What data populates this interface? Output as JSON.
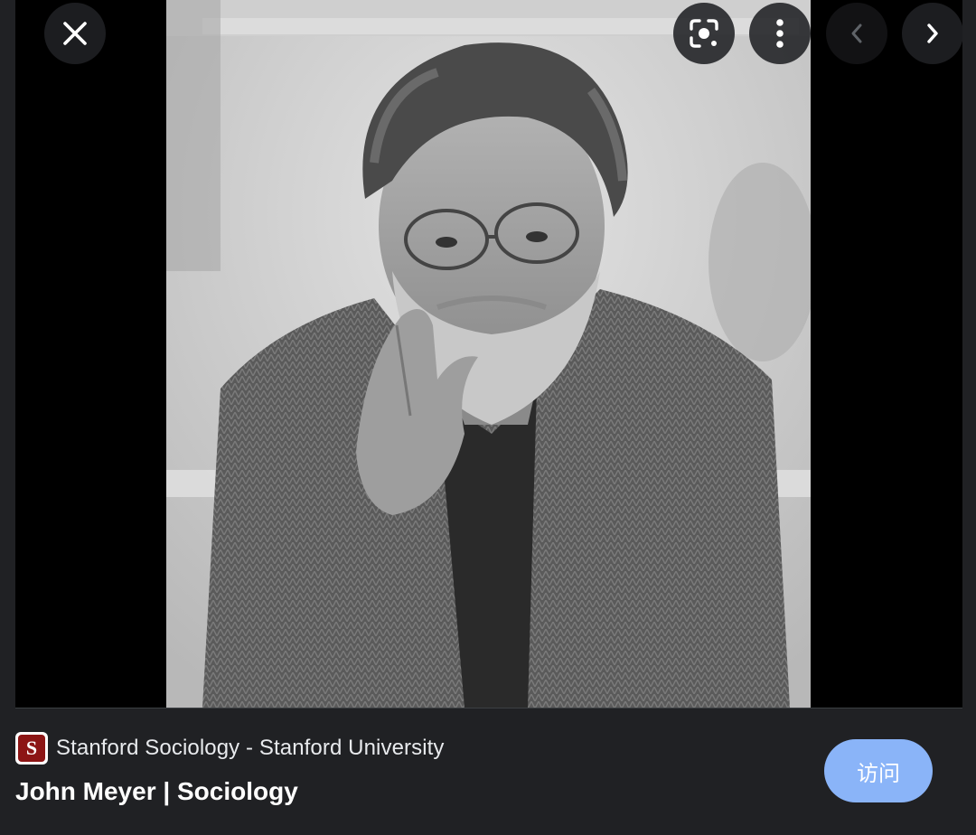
{
  "image_viewer": {
    "photo_alt": "Black and white portrait of a bearded man with glasses in a herringbone jacket"
  },
  "toolbar": {
    "close_icon": "close-icon",
    "lens_icon": "lens-icon",
    "more_icon": "more-vert-icon",
    "prev_icon": "chevron-left-icon",
    "next_icon": "chevron-right-icon"
  },
  "source": {
    "name": "Stanford Sociology - Stanford University",
    "favicon_letter": "S",
    "favicon_color": "#8c1515"
  },
  "result": {
    "title": "John Meyer | Sociology"
  },
  "visit_button": {
    "label": "访问",
    "color": "#8ab4f8"
  }
}
